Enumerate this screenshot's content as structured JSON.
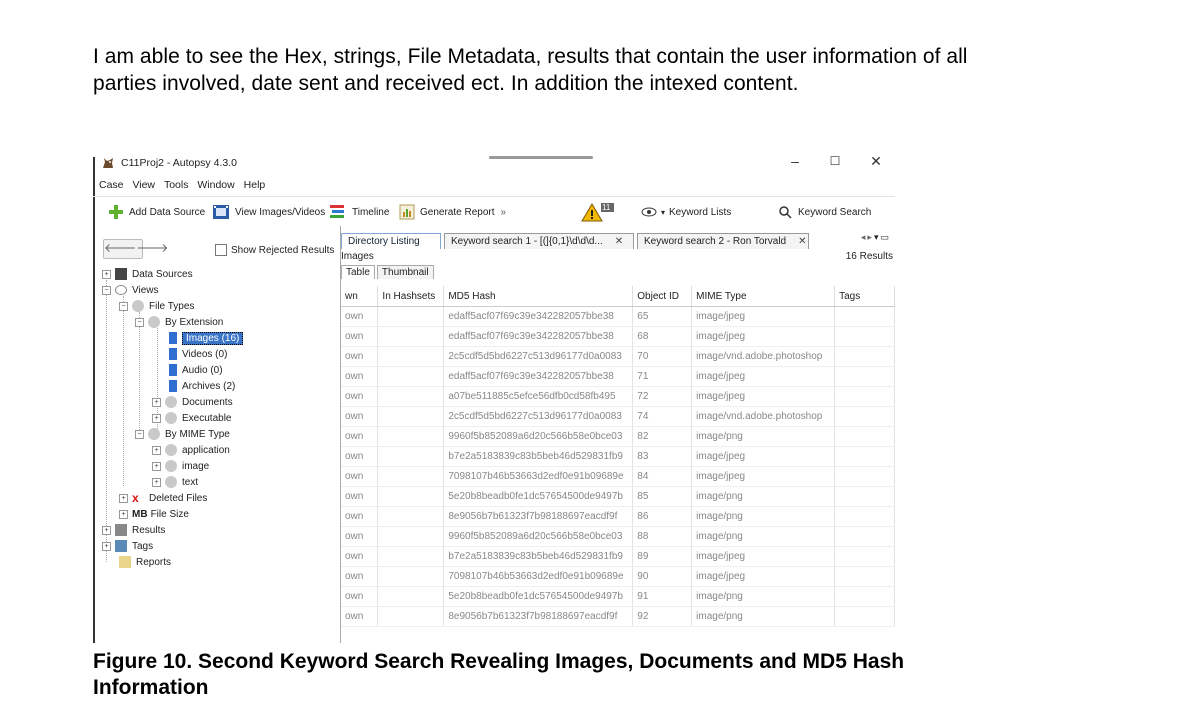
{
  "paragraph": "I am able to see the Hex, strings, File Metadata, results that contain the user information of all parties involved, date sent and received ect. In addition the intexed content.",
  "caption": "Figure 10. Second Keyword Search Revealing Images, Documents and MD5 Hash Information",
  "screenshot": {
    "window_title": "C11Proj2 - Autopsy 4.3.0",
    "window_controls": {
      "minimize": "–",
      "maximize": "☐",
      "close": "✕"
    },
    "menu": [
      "Case",
      "View",
      "Tools",
      "Window",
      "Help"
    ],
    "toolbar": {
      "add_data_source": "Add Data Source",
      "view_images_videos": "View Images/Videos",
      "timeline": "Timeline",
      "generate_report": "Generate Report",
      "alert_count": "11",
      "keyword_lists": "Keyword Lists",
      "keyword_search": "Keyword Search"
    },
    "left_pane": {
      "show_rejected": "Show Rejected Results",
      "tree": {
        "data_sources": "Data Sources",
        "views": "Views",
        "file_types": "File Types",
        "by_extension": "By Extension",
        "images": "Images (16)",
        "videos": "Videos (0)",
        "audio": "Audio (0)",
        "archives": "Archives (2)",
        "documents": "Documents",
        "executable": "Executable",
        "by_mime_type": "By MIME Type",
        "application": "application",
        "image": "image",
        "text": "text",
        "deleted_files": "Deleted Files",
        "file_size_prefix": "MB",
        "file_size": "File Size",
        "results": "Results",
        "tags": "Tags",
        "reports": "Reports"
      }
    },
    "right_pane": {
      "tabs": [
        {
          "label": "Directory Listing"
        },
        {
          "label": "Keyword search 1 - [(]{0,1}\\d\\d\\d...",
          "close": "✕"
        },
        {
          "label": "Keyword search 2 - Ron Torvald",
          "close": "✕"
        }
      ],
      "breadcrumb": "Images",
      "results_count": "16  Results",
      "subtabs": [
        "Table",
        "Thumbnail"
      ],
      "columns": [
        "wn",
        "In Hashsets",
        "MD5 Hash",
        "Object ID",
        "MIME Type",
        "Tags"
      ],
      "rows": [
        [
          "own",
          "",
          "edaff5acf07f69c39e342282057bbe38",
          "65",
          "image/jpeg",
          ""
        ],
        [
          "own",
          "",
          "edaff5acf07f69c39e342282057bbe38",
          "68",
          "image/jpeg",
          ""
        ],
        [
          "own",
          "",
          "2c5cdf5d5bd6227c513d96177d0a0083",
          "70",
          "image/vnd.adobe.photoshop",
          ""
        ],
        [
          "own",
          "",
          "edaff5acf07f69c39e342282057bbe38",
          "71",
          "image/jpeg",
          ""
        ],
        [
          "own",
          "",
          "a07be511885c5efce56dfb0cd58fb495",
          "72",
          "image/jpeg",
          ""
        ],
        [
          "own",
          "",
          "2c5cdf5d5bd6227c513d96177d0a0083",
          "74",
          "image/vnd.adobe.photoshop",
          ""
        ],
        [
          "own",
          "",
          "9960f5b852089a6d20c566b58e0bce03",
          "82",
          "image/png",
          ""
        ],
        [
          "own",
          "",
          "b7e2a5183839c83b5beb46d529831fb9",
          "83",
          "image/jpeg",
          ""
        ],
        [
          "own",
          "",
          "7098107b46b53663d2edf0e91b09689e",
          "84",
          "image/jpeg",
          ""
        ],
        [
          "own",
          "",
          "5e20b8beadb0fe1dc57654500de9497b",
          "85",
          "image/png",
          ""
        ],
        [
          "own",
          "",
          "8e9056b7b61323f7b98188697eacdf9f",
          "86",
          "image/png",
          ""
        ],
        [
          "own",
          "",
          "9960f5b852089a6d20c566b58e0bce03",
          "88",
          "image/png",
          ""
        ],
        [
          "own",
          "",
          "b7e2a5183839c83b5beb46d529831fb9",
          "89",
          "image/jpeg",
          ""
        ],
        [
          "own",
          "",
          "7098107b46b53663d2edf0e91b09689e",
          "90",
          "image/jpeg",
          ""
        ],
        [
          "own",
          "",
          "5e20b8beadb0fe1dc57654500de9497b",
          "91",
          "image/png",
          ""
        ],
        [
          "own",
          "",
          "8e9056b7b61323f7b98188697eacdf9f",
          "92",
          "image/png",
          ""
        ]
      ]
    }
  }
}
